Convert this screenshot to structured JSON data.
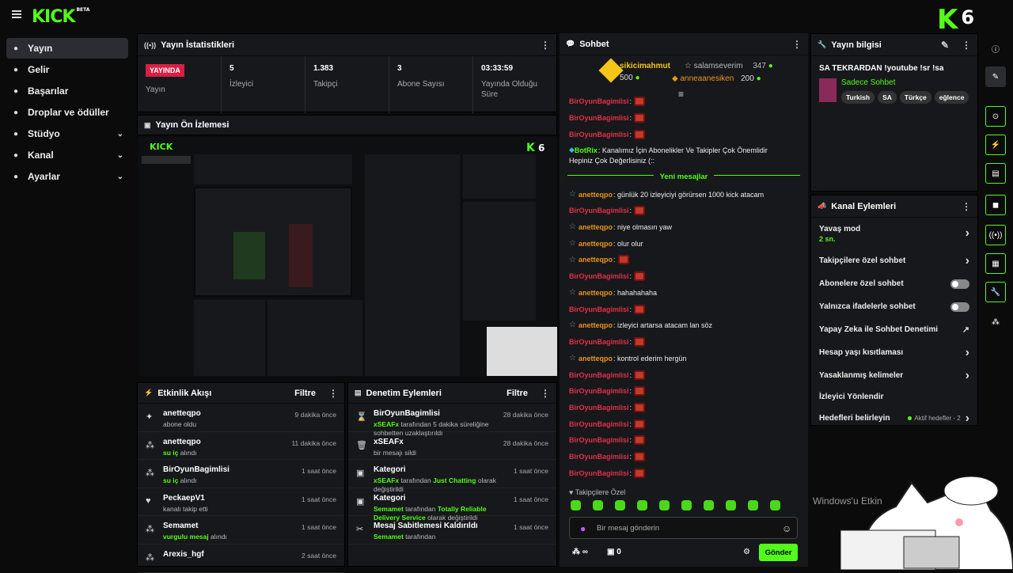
{
  "brand": {
    "logo": "KICK",
    "beta": "BETA",
    "count": "6"
  },
  "sidebar": [
    {
      "label": "Yayın",
      "icon": "broadcast-icon",
      "active": true
    },
    {
      "label": "Gelir",
      "icon": "revenue-icon"
    },
    {
      "label": "Başarılar",
      "icon": "trophy-icon"
    },
    {
      "label": "Droplar ve ödüller",
      "icon": "gift-icon"
    },
    {
      "label": "Stüdyo",
      "icon": "studio-icon",
      "chevron": true
    },
    {
      "label": "Kanal",
      "icon": "channel-icon",
      "chevron": true
    },
    {
      "label": "Ayarlar",
      "icon": "gear-icon",
      "chevron": true
    }
  ],
  "stats": {
    "title": "Yayın İstatistikleri",
    "live": "YAYINDA",
    "live_sub": "Yayın",
    "items": [
      {
        "v": "5",
        "l": "İzleyici"
      },
      {
        "v": "1.383",
        "l": "Takipçi"
      },
      {
        "v": "3",
        "l": "Abone Sayısı"
      },
      {
        "v": "03:33:59",
        "l": "Yayında Olduğu Süre"
      }
    ]
  },
  "preview": {
    "title": "Yayın Ön İzlemesi"
  },
  "feed": {
    "title": "Etkinlik Akışı",
    "filter": "Filtre",
    "items": [
      {
        "name": "anetteqpo",
        "pre": "",
        "hl": "",
        "post": "abone oldu",
        "time": "9 dakika önce",
        "icon": "sparkle-icon"
      },
      {
        "name": "anetteqpo",
        "pre": "",
        "hl": "su iç",
        "post": " alındı",
        "time": "11 dakika önce",
        "icon": "drop-icon"
      },
      {
        "name": "BirOyunBagimlisi",
        "pre": "",
        "hl": "su iç",
        "post": " alındı",
        "time": "1 saat önce",
        "icon": "drop-icon"
      },
      {
        "name": "PeckaepV1",
        "pre": "",
        "hl": "",
        "post": "kanalı takip etti",
        "time": "1 saat önce",
        "icon": "heart-icon"
      },
      {
        "name": "Semamet",
        "pre": "",
        "hl": "vurgulu mesaj",
        "post": " alındı",
        "time": "1 saat önce",
        "icon": "drop-icon"
      },
      {
        "name": "Arexis_hgf",
        "pre": "",
        "hl": "",
        "post": "",
        "time": "2 saat önce",
        "icon": "drop-icon"
      }
    ]
  },
  "mod": {
    "title": "Denetim Eylemleri",
    "filter": "Filtre",
    "items": [
      {
        "name": "BirOyunBagimlisi",
        "hl": "xSEAFx",
        "post": " tarafından 5 dakika süreliğine sohbetten uzaklaştırıldı",
        "hl2": "",
        "post2": "",
        "time": "28 dakika önce",
        "icon": "hourglass-icon"
      },
      {
        "name": "xSEAFx",
        "hl": "",
        "post": "bir mesajı sildi",
        "hl2": "",
        "post2": "",
        "time": "28 dakika önce",
        "icon": "trash-icon"
      },
      {
        "name": "Kategori",
        "hl": "xSEAFx",
        "post": " tarafından ",
        "hl2": "Just Chatting",
        "post2": " olarak değiştirildi",
        "time": "1 saat önce",
        "icon": "category-icon"
      },
      {
        "name": "Kategori",
        "hl": "Semamet",
        "post": " tarafından ",
        "hl2": "Totally Reliable Delivery Service",
        "post2": " olarak değiştirildi",
        "time": "1 saat önce",
        "icon": "category-icon"
      },
      {
        "name": "Mesaj Sabitlemesi Kaldırıldı",
        "hl": "Semamet",
        "post": " tarafından",
        "hl2": "",
        "post2": "",
        "time": "1 saat önce",
        "icon": "unpin-icon"
      }
    ]
  },
  "chat": {
    "title": "Sohbet",
    "leaders": [
      {
        "name": "sikicimahmut",
        "pts": "500"
      },
      {
        "name": "salamseverim",
        "pts": "347"
      },
      {
        "name": "anneaanesiken",
        "pts": "200"
      }
    ],
    "messages": [
      {
        "u": "BirOyunBagimlisi",
        "c": "red",
        "t": ":"
      },
      {
        "u": "BirOyunBagimlisi",
        "c": "red",
        "t": ":"
      },
      {
        "u": "BirOyunBagimlisi",
        "c": "red",
        "t": ":"
      },
      {
        "u": "BotRix",
        "c": "grn",
        "t": ": Kanalımız İçin Abonelikler Ve Takipler Çok Önemlidir",
        "t2": "Hepiniz Çok Değerlisiniz (::"
      },
      {
        "u": "anetteqpo",
        "c": "org",
        "t": ": günlük 20 izleyiciyi görürsen 1000 kick atacam"
      },
      {
        "u": "BirOyunBagimlisi",
        "c": "red",
        "t": ":"
      },
      {
        "u": "anetteqpo",
        "c": "org",
        "t": ": niye olmasın yaw"
      },
      {
        "u": "anetteqpo",
        "c": "org",
        "t": ": olur olur"
      },
      {
        "u": "anetteqpo",
        "c": "org",
        "t": ":"
      },
      {
        "u": "BirOyunBagimlisi",
        "c": "red",
        "t": ":"
      },
      {
        "u": "anetteqpo",
        "c": "org",
        "t": ": hahahahaha"
      },
      {
        "u": "BirOyunBagimlisi",
        "c": "red",
        "t": ":"
      },
      {
        "u": "anetteqpo",
        "c": "org",
        "t": ": izleyici artarsa atacam lan söz"
      },
      {
        "u": "BirOyunBagimlisi",
        "c": "red",
        "t": ":"
      },
      {
        "u": "anetteqpo",
        "c": "org",
        "t": ": kontrol ederim hergün"
      },
      {
        "u": "BirOyunBagimlisi",
        "c": "red",
        "t": ":"
      },
      {
        "u": "BirOyunBagimlisi",
        "c": "red",
        "t": ":"
      },
      {
        "u": "BirOyunBagimlisi",
        "c": "red",
        "t": ":"
      },
      {
        "u": "BirOyunBagimlisi",
        "c": "red",
        "t": ":"
      },
      {
        "u": "BirOyunBagimlisi",
        "c": "red",
        "t": ":"
      },
      {
        "u": "BirOyunBagimlisi",
        "c": "red",
        "t": ":"
      },
      {
        "u": "BirOyunBagimlisi",
        "c": "red",
        "t": ":"
      }
    ],
    "new_label": "Yeni mesajlar",
    "followers_only": "Takipçilere Özel",
    "placeholder": "Bir mesaj gönderin",
    "send": "Gönder",
    "infinity": "∞",
    "gifts": "0"
  },
  "info": {
    "title": "Yayın bilgisi",
    "stream_title": "SA TEKRARDAN !youtube !sr !sa",
    "category": "Sadece Sohbet",
    "tags": [
      "Turkish",
      "SA",
      "Türkçe",
      "eğlence"
    ]
  },
  "actions": {
    "title": "Kanal Eylemleri",
    "items": [
      {
        "label": "Yavaş mod",
        "sub": "2 sn.",
        "type": "chev"
      },
      {
        "label": "Takipçilere özel sohbet",
        "type": "chev"
      },
      {
        "label": "Abonelere özel sohbet",
        "type": "toggle"
      },
      {
        "label": "Yalnızca ifadelerle sohbet",
        "type": "toggle"
      },
      {
        "label": "Yapay Zeka ile Sohbet Denetimi",
        "type": "ext"
      },
      {
        "label": "Hesap yaşı kısıtlaması",
        "type": "chev"
      },
      {
        "label": "Yasaklanmış kelimeler",
        "type": "chev"
      },
      {
        "label": "İzleyici Yönlendir",
        "type": "none"
      },
      {
        "label": "Hedefleri belirleyin",
        "extra": "Aktif hedefler - 2",
        "type": "chev"
      }
    ]
  },
  "watermark": "Windows'u Etkin",
  "colors": {
    "accent": "#53fc18",
    "live": "#d81f44"
  }
}
